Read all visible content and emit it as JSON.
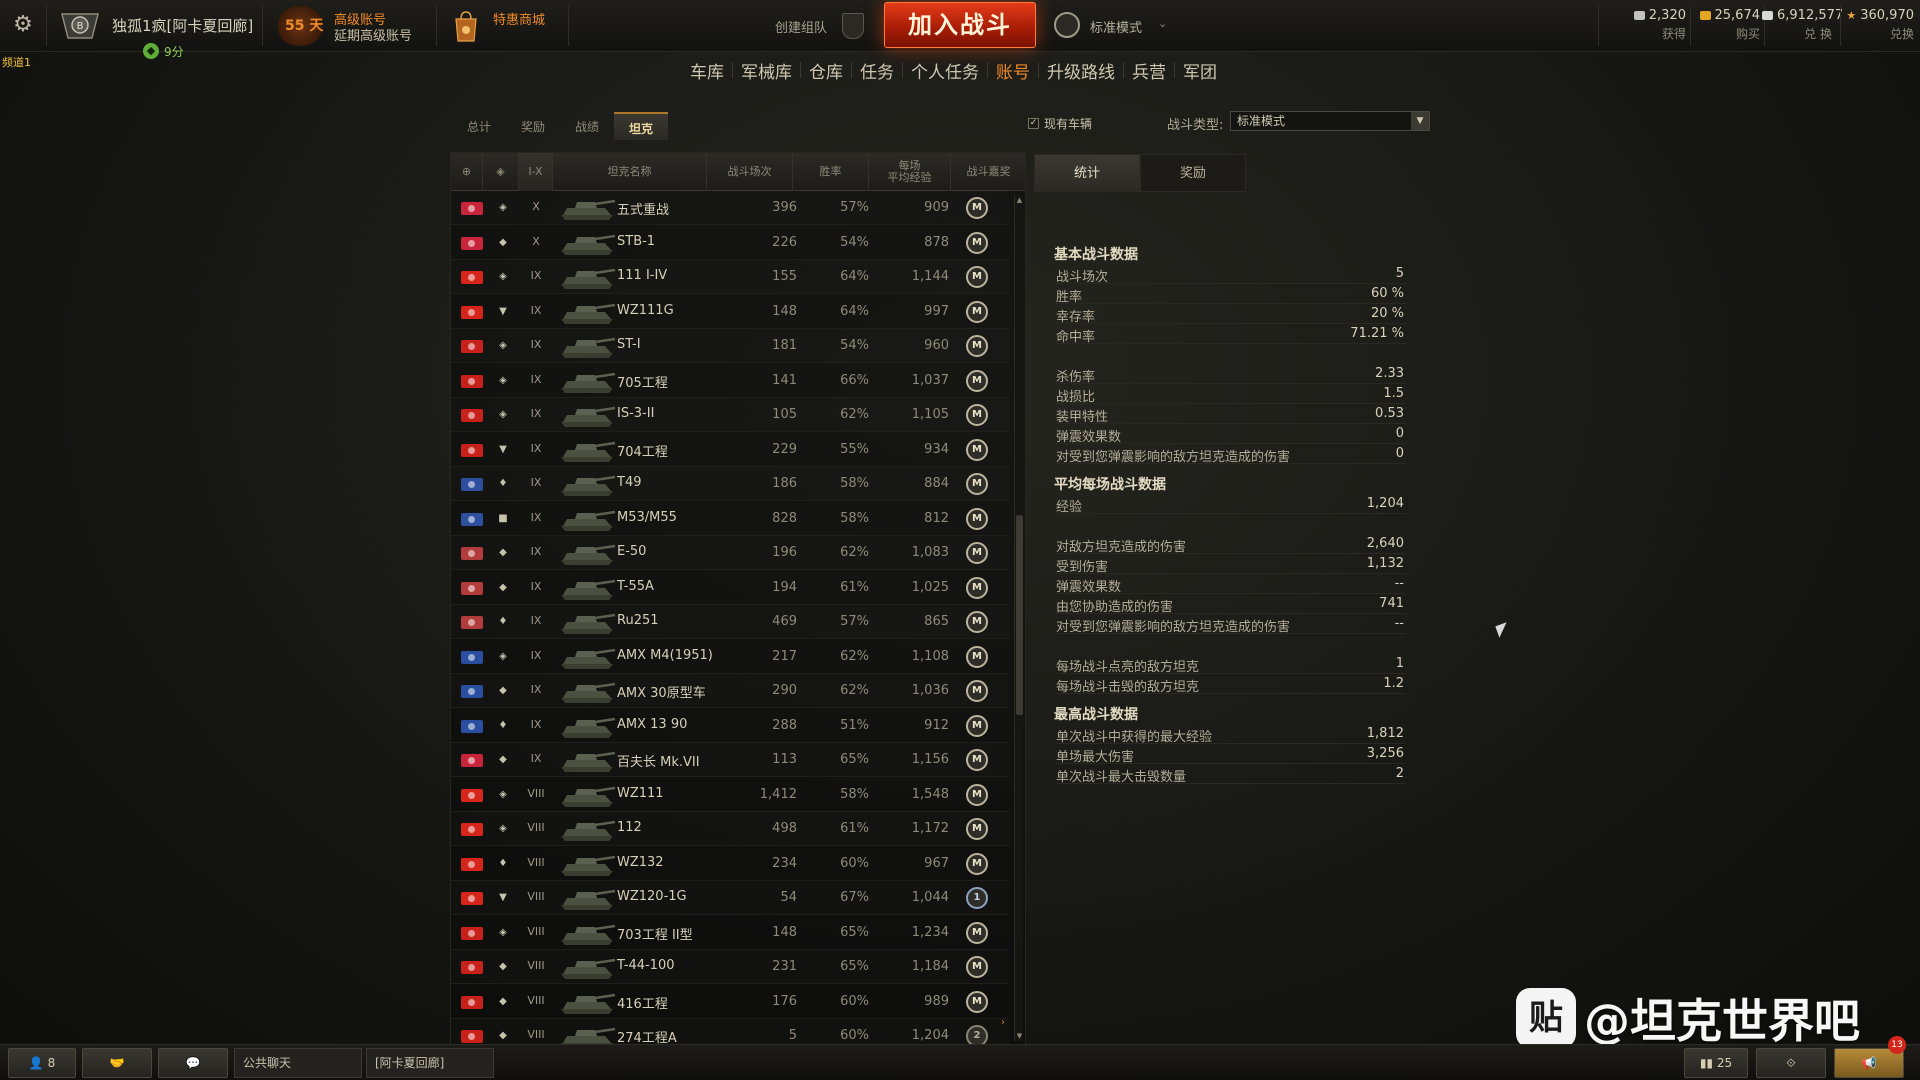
{
  "topbar": {
    "player_name": "独孤1疯[阿卡夏回廊]",
    "online_count": "9分",
    "premium_days": "55 天",
    "premium_title": "高级账号",
    "premium_extend": "延期高级账号",
    "shop_label": "特惠商城",
    "create_squad": "创建组队",
    "battle_button": "加入战斗",
    "battle_mode": "标准模式",
    "currencies": [
      {
        "value": "2,320",
        "label": "获得",
        "color": "#c2c2c2"
      },
      {
        "value": "25,674",
        "label": "购买",
        "color": "#e5a623"
      },
      {
        "value": "6,912,577",
        "label": "兑 换",
        "color": "#d7d7d7"
      },
      {
        "value": "360,970",
        "label": "兑换",
        "color": "#e8a43a"
      }
    ]
  },
  "channel_tag": "频道1",
  "nav": {
    "items": [
      "车库",
      "军械库",
      "仓库",
      "任务",
      "个人任务",
      "账号",
      "升级路线",
      "兵营",
      "军团"
    ],
    "active_index": 5
  },
  "sub_tabs": {
    "items": [
      "总计",
      "奖励",
      "战绩",
      "坦克"
    ],
    "active_index": 3
  },
  "filter": {
    "checkbox_label": "现有车辆",
    "checked": true,
    "battle_type_label": "战斗类型:",
    "battle_type_value": "标准模式"
  },
  "table": {
    "headers": {
      "nation": "",
      "type": "",
      "tier": "I-X",
      "name": "坦克名称",
      "battles": "战斗场次",
      "winrate": "胜率",
      "avgxp_line1": "每场",
      "avgxp_line2": "平均经验",
      "mastery": "战斗嘉奖"
    },
    "rows": [
      {
        "nation": "uk",
        "type": "heavy",
        "tier": "X",
        "name": "五式重战",
        "battles": "396",
        "winrate": "57%",
        "avgxp": "909",
        "mastery": "M"
      },
      {
        "nation": "uk",
        "type": "medium",
        "tier": "X",
        "name": "STB-1",
        "battles": "226",
        "winrate": "54%",
        "avgxp": "878",
        "mastery": "M"
      },
      {
        "nation": "china",
        "type": "heavy",
        "tier": "IX",
        "name": "111 I-IV",
        "battles": "155",
        "winrate": "64%",
        "avgxp": "1,144",
        "mastery": "M"
      },
      {
        "nation": "china",
        "type": "td",
        "tier": "IX",
        "name": "WZ111G",
        "battles": "148",
        "winrate": "64%",
        "avgxp": "997",
        "mastery": "M"
      },
      {
        "nation": "ussr",
        "type": "heavy",
        "tier": "IX",
        "name": "ST-I",
        "battles": "181",
        "winrate": "54%",
        "avgxp": "960",
        "mastery": "M"
      },
      {
        "nation": "ussr",
        "type": "heavy",
        "tier": "IX",
        "name": "705工程",
        "battles": "141",
        "winrate": "66%",
        "avgxp": "1,037",
        "mastery": "M"
      },
      {
        "nation": "ussr",
        "type": "heavy",
        "tier": "IX",
        "name": "IS-3-II",
        "battles": "105",
        "winrate": "62%",
        "avgxp": "1,105",
        "mastery": "M"
      },
      {
        "nation": "ussr",
        "type": "td",
        "tier": "IX",
        "name": "704工程",
        "battles": "229",
        "winrate": "55%",
        "avgxp": "934",
        "mastery": "M"
      },
      {
        "nation": "usa",
        "type": "light",
        "tier": "IX",
        "name": "T49",
        "battles": "186",
        "winrate": "58%",
        "avgxp": "884",
        "mastery": "M"
      },
      {
        "nation": "usa",
        "type": "spg",
        "tier": "IX",
        "name": "M53/M55",
        "battles": "828",
        "winrate": "58%",
        "avgxp": "812",
        "mastery": "M"
      },
      {
        "nation": "germany",
        "type": "medium",
        "tier": "IX",
        "name": "E-50",
        "battles": "196",
        "winrate": "62%",
        "avgxp": "1,083",
        "mastery": "M"
      },
      {
        "nation": "germany",
        "type": "medium",
        "tier": "IX",
        "name": "T-55A",
        "battles": "194",
        "winrate": "61%",
        "avgxp": "1,025",
        "mastery": "M"
      },
      {
        "nation": "germany",
        "type": "light",
        "tier": "IX",
        "name": "Ru251",
        "battles": "469",
        "winrate": "57%",
        "avgxp": "865",
        "mastery": "M"
      },
      {
        "nation": "france",
        "type": "heavy",
        "tier": "IX",
        "name": "AMX M4(1951)",
        "battles": "217",
        "winrate": "62%",
        "avgxp": "1,108",
        "mastery": "M"
      },
      {
        "nation": "france",
        "type": "medium",
        "tier": "IX",
        "name": "AMX 30原型车",
        "battles": "290",
        "winrate": "62%",
        "avgxp": "1,036",
        "mastery": "M"
      },
      {
        "nation": "france",
        "type": "light",
        "tier": "IX",
        "name": "AMX 13 90",
        "battles": "288",
        "winrate": "51%",
        "avgxp": "912",
        "mastery": "M"
      },
      {
        "nation": "uk",
        "type": "medium",
        "tier": "IX",
        "name": "百夫长 Mk.VII",
        "battles": "113",
        "winrate": "65%",
        "avgxp": "1,156",
        "mastery": "M"
      },
      {
        "nation": "china",
        "type": "heavy",
        "tier": "VIII",
        "name": "WZ111",
        "battles": "1,412",
        "winrate": "58%",
        "avgxp": "1,548",
        "mastery": "M"
      },
      {
        "nation": "china",
        "type": "heavy",
        "tier": "VIII",
        "name": "112",
        "battles": "498",
        "winrate": "61%",
        "avgxp": "1,172",
        "mastery": "M"
      },
      {
        "nation": "china",
        "type": "light",
        "tier": "VIII",
        "name": "WZ132",
        "battles": "234",
        "winrate": "60%",
        "avgxp": "967",
        "mastery": "M"
      },
      {
        "nation": "china",
        "type": "td",
        "tier": "VIII",
        "name": "WZ120-1G",
        "battles": "54",
        "winrate": "67%",
        "avgxp": "1,044",
        "mastery": "1"
      },
      {
        "nation": "ussr",
        "type": "heavy",
        "tier": "VIII",
        "name": "703工程 II型",
        "battles": "148",
        "winrate": "65%",
        "avgxp": "1,234",
        "mastery": "M"
      },
      {
        "nation": "ussr",
        "type": "medium",
        "tier": "VIII",
        "name": "T-44-100",
        "battles": "231",
        "winrate": "65%",
        "avgxp": "1,184",
        "mastery": "M"
      },
      {
        "nation": "ussr",
        "type": "medium",
        "tier": "VIII",
        "name": "416工程",
        "battles": "176",
        "winrate": "60%",
        "avgxp": "989",
        "mastery": "M"
      },
      {
        "nation": "ussr",
        "type": "medium",
        "tier": "VIII",
        "name": "274工程A",
        "battles": "5",
        "winrate": "60%",
        "avgxp": "1,204",
        "mastery": "2"
      }
    ]
  },
  "stats_tabs": [
    "统计",
    "奖励"
  ],
  "stats": {
    "basic_title": "基本战斗数据",
    "basic": [
      {
        "label": "战斗场次",
        "value": "5"
      },
      {
        "label": "胜率",
        "value": "60 %"
      },
      {
        "label": "幸存率",
        "value": "20 %"
      },
      {
        "label": "命中率",
        "value": "71.21 %"
      }
    ],
    "basic2": [
      {
        "label": "杀伤率",
        "value": "2.33"
      },
      {
        "label": "战损比",
        "value": "1.5"
      },
      {
        "label": "装甲特性",
        "value": "0.53"
      },
      {
        "label": "弹震效果数",
        "value": "0"
      },
      {
        "label": "对受到您弹震影响的敌方坦克造成的伤害",
        "value": "0"
      }
    ],
    "avg_title": "平均每场战斗数据",
    "avg": [
      {
        "label": "经验",
        "value": "1,204"
      }
    ],
    "avg2": [
      {
        "label": "对敌方坦克造成的伤害",
        "value": "2,640"
      },
      {
        "label": "受到伤害",
        "value": "1,132"
      },
      {
        "label": "弹震效果数",
        "value": "--"
      },
      {
        "label": "由您协助造成的伤害",
        "value": "741"
      },
      {
        "label": "对受到您弹震影响的敌方坦克造成的伤害",
        "value": "--"
      }
    ],
    "avg3": [
      {
        "label": "每场战斗点亮的敌方坦克",
        "value": "1"
      },
      {
        "label": "每场战斗击毁的敌方坦克",
        "value": "1.2"
      }
    ],
    "max_title": "最高战斗数据",
    "max": [
      {
        "label": "单次战斗中获得的最大经验",
        "value": "1,812"
      },
      {
        "label": "单场最大伤害",
        "value": "3,256"
      },
      {
        "label": "单次战斗最大击毁数量",
        "value": "2"
      }
    ]
  },
  "bottombar": {
    "friends_count": "8",
    "public_chat": "公共聊天",
    "clan_chat": "[阿卡夏回廊]",
    "right_count": "25",
    "notif_count": "13"
  },
  "watermark": {
    "logo": "贴",
    "text": "@坦克世界吧"
  },
  "nation_colors": {
    "uk": "#c7263a",
    "china": "#d6261c",
    "ussr": "#c8201a",
    "usa": "#2d4f9e",
    "germany": "#b23b3b",
    "france": "#2a4ea0"
  }
}
